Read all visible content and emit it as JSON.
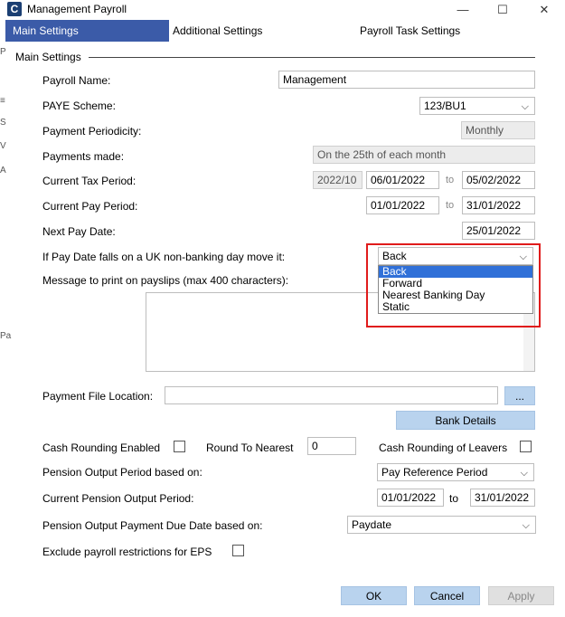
{
  "window": {
    "title": "Management Payroll",
    "app_icon": "C",
    "minimize": "—",
    "maximize": "☐",
    "close": "✕"
  },
  "left_fragments": [
    "P",
    "≡",
    "S",
    "V",
    "A",
    "Pa"
  ],
  "tabs": [
    {
      "label": "Main Settings",
      "active": true
    },
    {
      "label": "Additional Settings",
      "active": false
    },
    {
      "label": "Payroll Task Settings",
      "active": false
    }
  ],
  "section": {
    "title": "Main Settings"
  },
  "fields": {
    "payroll_name": {
      "label": "Payroll Name:",
      "value": "Management"
    },
    "paye_scheme": {
      "label": "PAYE Scheme:",
      "value": "123/BU1"
    },
    "payment_periodicity": {
      "label": "Payment Periodicity:",
      "value": "Monthly"
    },
    "payments_made": {
      "label": "Payments made:",
      "value": "On the 25th of each month"
    },
    "current_tax_period": {
      "label": "Current Tax Period:",
      "period": "2022/10",
      "from": "06/01/2022",
      "to_label": "to",
      "to": "05/02/2022"
    },
    "current_pay_period": {
      "label": "Current Pay Period:",
      "from": "01/01/2022",
      "to_label": "to",
      "to": "31/01/2022"
    },
    "next_pay_date": {
      "label": "Next Pay Date:",
      "value": "25/01/2022"
    },
    "non_banking": {
      "label": "If Pay Date falls on a UK non-banking day move it:",
      "value": "Back"
    },
    "message": {
      "label": "Message to print on payslips (max 400 characters):",
      "value": ""
    },
    "payment_file": {
      "label": "Payment File Location:",
      "value": "",
      "browse": "..."
    },
    "bank_details": {
      "label": "Bank Details"
    },
    "cash_rounding": {
      "label": "Cash Rounding Enabled"
    },
    "round_to_nearest": {
      "label": "Round To Nearest",
      "value": "0"
    },
    "cash_rounding_leavers": {
      "label": "Cash Rounding of Leavers"
    },
    "pension_period_based": {
      "label": "Pension Output Period based on:",
      "value": "Pay Reference Period"
    },
    "current_pension_period": {
      "label": "Current Pension Output Period:",
      "from": "01/01/2022",
      "to_label": "to",
      "to": "31/01/2022"
    },
    "pension_payment_due": {
      "label": "Pension Output Payment Due Date based on:",
      "value": "Paydate"
    },
    "exclude_restrictions": {
      "label": "Exclude payroll restrictions for EPS"
    }
  },
  "dropdown_options": [
    "Back",
    "Forward",
    "Nearest Banking Day",
    "Static"
  ],
  "buttons": {
    "ok": "OK",
    "cancel": "Cancel",
    "apply": "Apply"
  },
  "colors": {
    "tab_active": "#3b5ba8",
    "button_blue": "#b9d3ee",
    "highlight": "#e01b1b",
    "selection": "#3070d8"
  }
}
